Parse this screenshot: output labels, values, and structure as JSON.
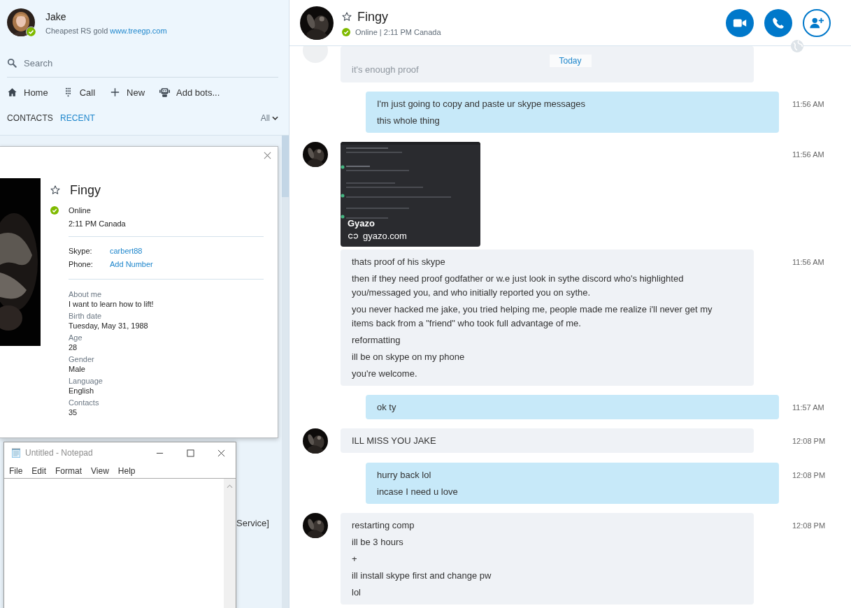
{
  "sidebar": {
    "user": {
      "name": "Jake",
      "online": true,
      "mood_text": "Cheapest RS gold",
      "mood_link": "www.treegp.com"
    },
    "search": {
      "placeholder": "Search"
    },
    "nav": [
      {
        "kind": "home",
        "label": "Home"
      },
      {
        "kind": "dialpad",
        "label": "Call"
      },
      {
        "kind": "plus",
        "label": "New"
      },
      {
        "kind": "bot",
        "label": "Add bots..."
      }
    ],
    "tabs": [
      {
        "label": "CONTACTS",
        "selected": false
      },
      {
        "label": "RECENT",
        "selected": true
      }
    ],
    "filter": "All",
    "list_fragment": "Service]"
  },
  "chat": {
    "contact": {
      "name": "Fingy",
      "favorite": false,
      "online": true,
      "status_line": "Online | 2:11 PM Canada"
    },
    "actions": [
      {
        "kind": "video"
      },
      {
        "kind": "call"
      },
      {
        "kind": "add-contact"
      }
    ],
    "date_divider": "Today",
    "faded_message": "it's enough proof",
    "messages": [
      {
        "outgoing": true,
        "avatar": false,
        "kind": "text",
        "time": "11:56 AM",
        "paragraphs": [
          "I'm just going to copy and paste ur skype messages",
          "this whole thing"
        ]
      },
      {
        "outgoing": false,
        "avatar": true,
        "kind": "link-preview",
        "time": "11:56 AM",
        "title": "Gyazo",
        "url": "gyazo.com"
      },
      {
        "outgoing": false,
        "avatar": false,
        "kind": "text",
        "time": "11:56 AM",
        "paragraphs": [
          "thats proof of his skype",
          "then if they need proof godfather or w.e just look in sythe discord who's highlighted you/messaged you, and who initially reported you on sythe.",
          "you never hacked me jake, you tried helping me, people made me realize i'll never get my items back from a \"friend\" who took full advantage of me.",
          "reformatting",
          "ill be on skype on my phone",
          "you're welcome."
        ]
      },
      {
        "outgoing": true,
        "avatar": false,
        "kind": "text",
        "time": "11:57 AM",
        "paragraphs": [
          "ok ty"
        ]
      },
      {
        "outgoing": false,
        "avatar": true,
        "kind": "text",
        "time": "12:08 PM",
        "paragraphs": [
          "ILL MISS YOU JAKE"
        ]
      },
      {
        "outgoing": true,
        "avatar": false,
        "kind": "text",
        "time": "12:08 PM",
        "paragraphs": [
          "hurry back lol",
          "incase I need u love"
        ]
      },
      {
        "outgoing": false,
        "avatar": true,
        "kind": "text",
        "time": "12:08 PM",
        "paragraphs": [
          "restarting comp",
          "ill be 3 hours",
          "+",
          "ill install skype first and change pw",
          "lol"
        ]
      }
    ]
  },
  "profile_card": {
    "name": "Fingy",
    "favorite": false,
    "online": true,
    "status_text": "Online",
    "local_time": "2:11 PM Canada",
    "contact_info": [
      {
        "label": "Skype:",
        "value": "carbert88"
      },
      {
        "label": "Phone:",
        "value": "Add Number"
      }
    ],
    "details": [
      {
        "label": "About me",
        "value": "I want to learn how to lift!"
      },
      {
        "label": "Birth date",
        "value": "Tuesday, May 31, 1988"
      },
      {
        "label": "Age",
        "value": "28"
      },
      {
        "label": "Gender",
        "value": "Male"
      },
      {
        "label": "Language",
        "value": "English"
      },
      {
        "label": "Contacts",
        "value": "35"
      }
    ]
  },
  "notepad": {
    "title": "Untitled - Notepad",
    "menu": [
      "File",
      "Edit",
      "Format",
      "View",
      "Help"
    ]
  }
}
